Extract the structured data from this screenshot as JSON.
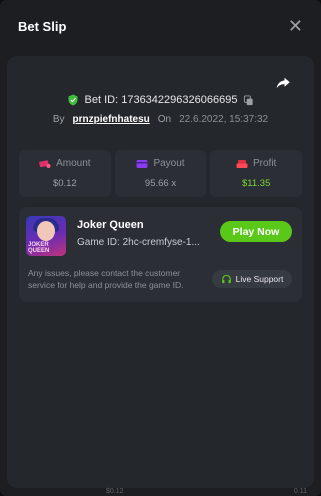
{
  "header": {
    "title": "Bet Slip"
  },
  "bet": {
    "id_label": "Bet ID: 1736342296326066695",
    "by_label": "By",
    "username": "prnzpiefnhatesu",
    "on_label": "On",
    "date": "22.6.2022, 15:37:32"
  },
  "stats": {
    "amount_label": "Amount",
    "amount_value": "$0.12",
    "payout_label": "Payout",
    "payout_value": "95.66 x",
    "profit_label": "Profit",
    "profit_value": "$11.35"
  },
  "game": {
    "name": "Joker Queen",
    "id_text": "Game ID: 2hc-cremfyse-1...",
    "thumb_text": "JOKER QUEEN",
    "play_label": "Play Now",
    "issue_text": "Any issues, please contact the customer service for help and provide the game ID.",
    "support_label": "Live Support"
  },
  "colors": {
    "accent_green": "#5ac818",
    "profit_green": "#7cd63a",
    "amount_icon": "#e0306a",
    "payout_icon": "#8a3df0",
    "profit_icon": "#e03040"
  },
  "icons": [
    "close-icon",
    "share-icon",
    "shield-check-icon",
    "copy-icon",
    "money-icon",
    "card-icon",
    "money-icon",
    "headset-icon"
  ],
  "background": {
    "left_value": "$0.12",
    "right_value": "0.11"
  }
}
